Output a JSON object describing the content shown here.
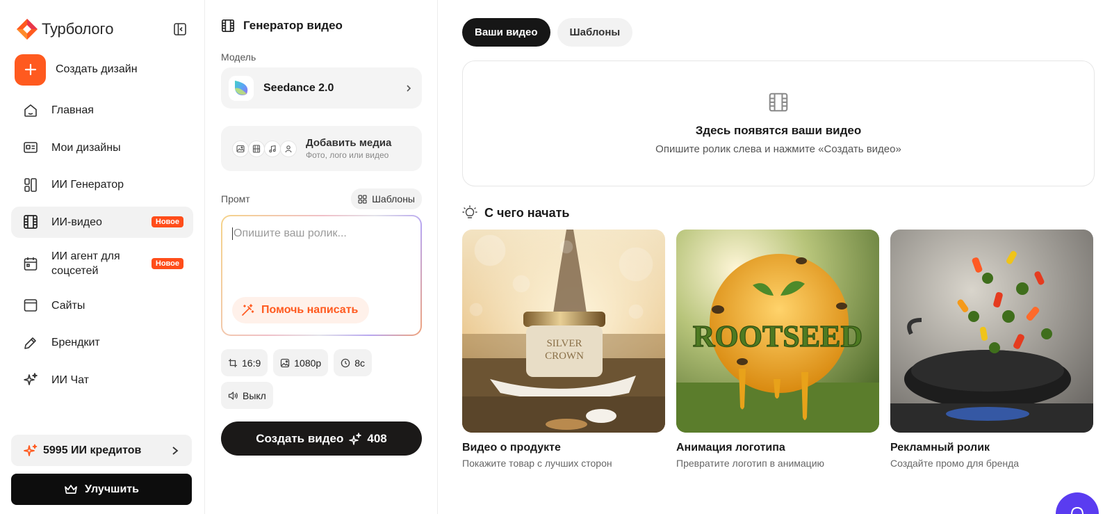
{
  "brand": {
    "name": "Турбологo"
  },
  "sidebar": {
    "create_label": "Создать дизайн",
    "items": [
      {
        "label": "Главная",
        "icon": "home-icon"
      },
      {
        "label": "Мои дизайны",
        "icon": "designs-icon"
      },
      {
        "label": "ИИ Генератор",
        "icon": "generator-icon"
      },
      {
        "label": "ИИ-видео",
        "icon": "film-icon",
        "badge": "Новое",
        "active": true
      },
      {
        "label": "ИИ агент для соцсетей",
        "icon": "calendar-icon",
        "badge": "Новое"
      },
      {
        "label": "Сайты",
        "icon": "browser-icon"
      },
      {
        "label": "Брендкит",
        "icon": "pen-icon"
      },
      {
        "label": "ИИ Чат",
        "icon": "sparkles-icon"
      }
    ],
    "credits_label": "5995 ИИ кредитов",
    "upgrade_label": "Улучшить"
  },
  "panel": {
    "title": "Генератор видео",
    "model_label": "Модель",
    "model_name": "Seedance 2.0",
    "media_title": "Добавить медиа",
    "media_subtitle": "Фото, лого или видео",
    "prompt_label": "Промт",
    "templates_label": "Шаблоны",
    "prompt_placeholder": "Опишите ваш ролик...",
    "help_label": "Помочь написать",
    "chips": {
      "ratio": "16:9",
      "resolution": "1080p",
      "duration": "8с",
      "sound": "Выкл"
    },
    "create_label": "Создать видео",
    "create_cost": "408"
  },
  "main": {
    "tabs": [
      {
        "label": "Ваши видео",
        "active": true
      },
      {
        "label": "Шаблоны",
        "active": false
      }
    ],
    "empty_title": "Здесь появятся ваши видео",
    "empty_subtitle": "Опишите ролик слева и нажмите «Создать видео»",
    "section_title": "С чего начать",
    "cards": [
      {
        "title": "Видео о продукте",
        "subtitle": "Покажите товар с лучших сторон",
        "image_text": "SILVER CROWN"
      },
      {
        "title": "Анимация логотипа",
        "subtitle": "Превратите логотип в анимацию",
        "image_text": "ROOTSEED"
      },
      {
        "title": "Рекламный ролик",
        "subtitle": "Создайте промо для бренда",
        "image_text": ""
      }
    ]
  },
  "colors": {
    "accent": "#ff5a1f",
    "dark": "#161616",
    "chat": "#5a3cf0"
  }
}
